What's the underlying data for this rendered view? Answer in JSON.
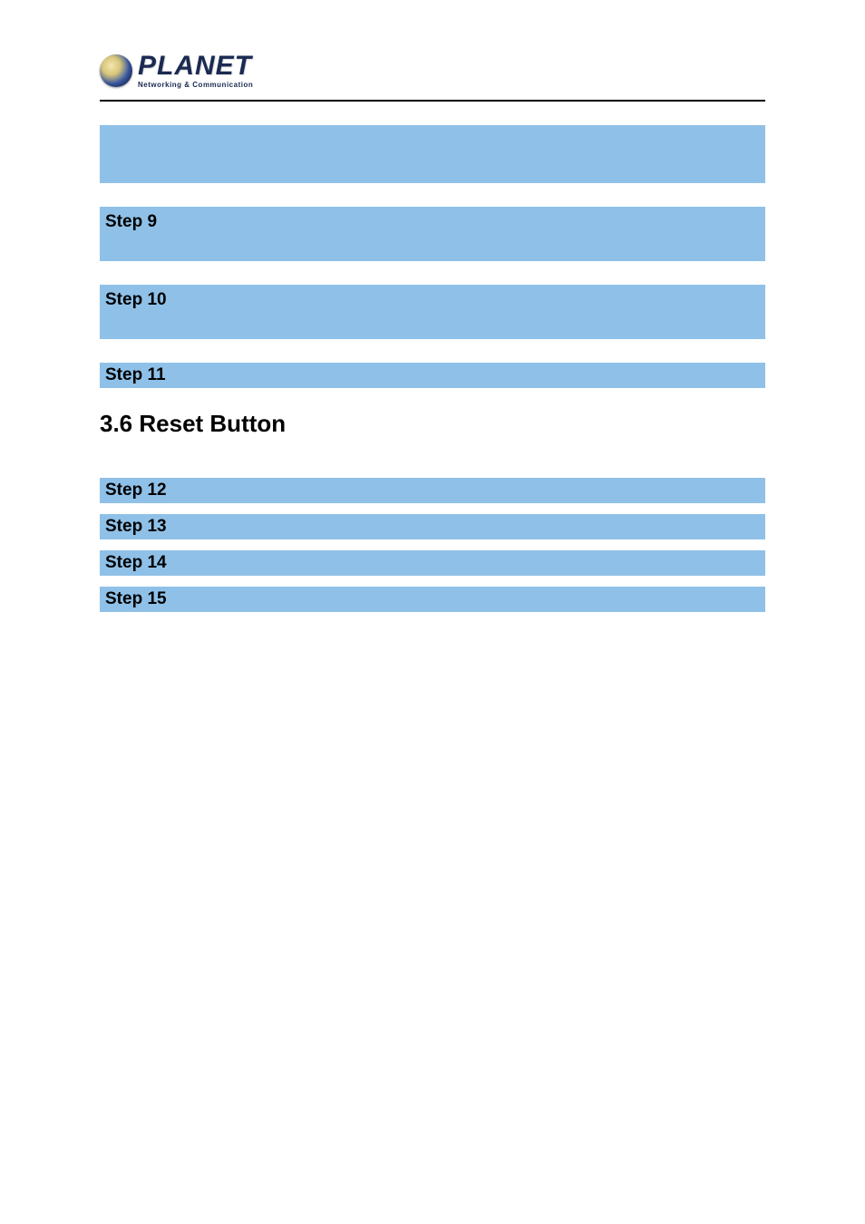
{
  "logo": {
    "word": "PLANET",
    "tagline": "Networking & Communication",
    "icon_name": "globe-icon"
  },
  "steps_top": [
    {
      "label": "Step 9"
    },
    {
      "label": "Step 10"
    },
    {
      "label": "Step 11"
    }
  ],
  "section": {
    "heading": "3.6 Reset Button"
  },
  "steps_bottom": [
    {
      "label": "Step 12"
    },
    {
      "label": "Step 13"
    },
    {
      "label": "Step 14"
    },
    {
      "label": "Step 15"
    }
  ],
  "colors": {
    "band": "#8fc1e8",
    "rule": "#000000"
  }
}
